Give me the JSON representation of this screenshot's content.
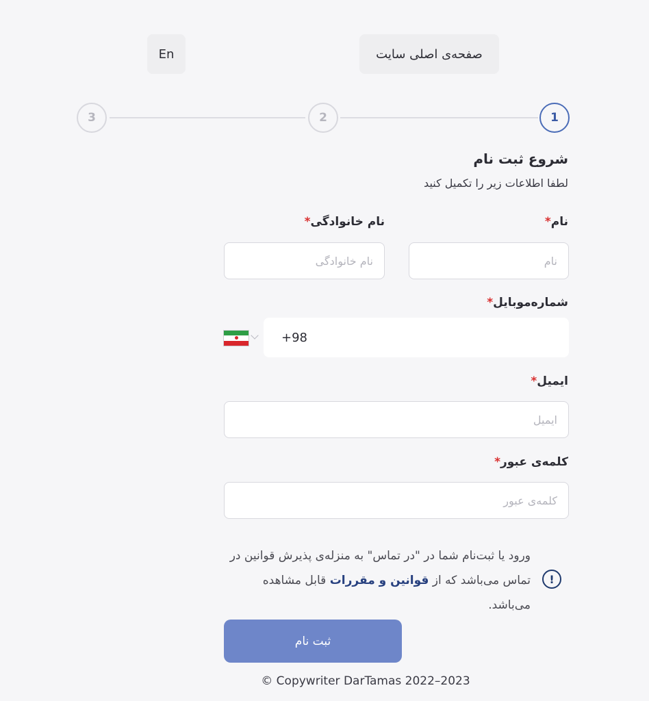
{
  "header": {
    "lang_label": "En",
    "home_label": "صفحه‌ی اصلی سایت"
  },
  "steps": [
    "1",
    "2",
    "3"
  ],
  "form": {
    "title": "شروع ثبت نام",
    "subtitle": "لطفا اطلاعات زیر را تکمیل کنید",
    "required_mark": "*",
    "first_name": {
      "label": "نام",
      "placeholder": "نام"
    },
    "last_name": {
      "label": "نام خانوادگی",
      "placeholder": "نام خانوادگی"
    },
    "mobile": {
      "label": "شماره‌موبایل",
      "country_code": "+98",
      "country_icon": "iran-flag-icon"
    },
    "email": {
      "label": "ایمیل",
      "placeholder": "ایمیل"
    },
    "password": {
      "label": "کلمه‌ی عبور",
      "placeholder": "کلمه‌ی عبور"
    },
    "notice": {
      "text_before": "ورود یا ثبت‌نام شما در \"در تماس\" به منزله‌ی پذیرش قوانین در تماس می‌باشد که از ",
      "link": "قوانین و مقررات",
      "text_after": " قابل مشاهده می‌باشد.",
      "icon": "info-circle-icon"
    },
    "submit_label": "ثبت نام"
  },
  "footer": {
    "copyright": "© Copywriter DarTamas 2022–2023"
  },
  "colors": {
    "background": "#f6f6f8",
    "accent": "#4a6cb7",
    "submit_button": "#6e86c9",
    "required": "#d93030",
    "link": "#27407f"
  }
}
